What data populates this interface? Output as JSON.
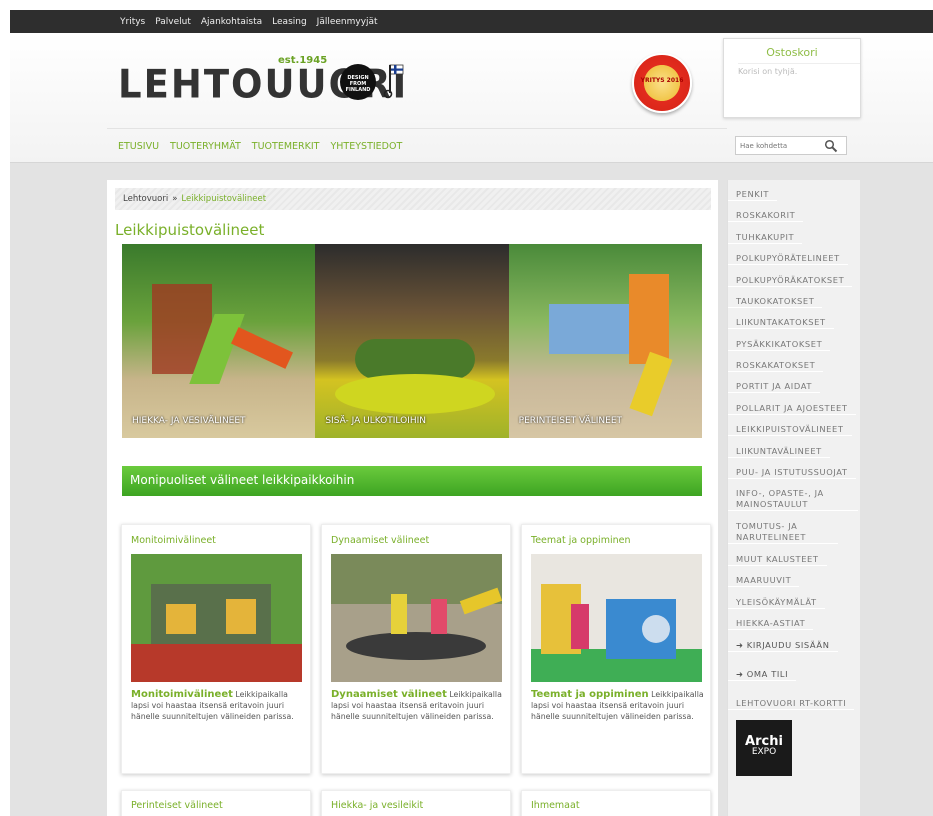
{
  "topnav": [
    "Yritys",
    "Palvelut",
    "Ajankohtaista",
    "Leasing",
    "Jälleenmyyjät"
  ],
  "logo": {
    "name": "LEHTOUUORI",
    "est": "est.1945"
  },
  "dff_badge": "DESIGN FROM FINLAND",
  "award_badge": "YRITYS 2016",
  "cart": {
    "title": "Ostoskori",
    "empty": "Korisi on tyhjä."
  },
  "mainnav": [
    "ETUSIVU",
    "TUOTERYHMÄT",
    "TUOTEMERKIT",
    "YHTEYSTIEDOT"
  ],
  "search": {
    "placeholder": "Hae kohdetta",
    "icon": "search-icon"
  },
  "breadcrumb": {
    "home": "Lehtovuori",
    "sep": "»",
    "current": "Leikkipuistovälineet"
  },
  "page_title": "Leikkipuistovälineet",
  "hero": [
    {
      "label": "HIEKKA- JA VESIVÄLINEET"
    },
    {
      "label": "SISÄ- JA ULKOTILOIHIN"
    },
    {
      "label": "PERINTEISET VÄLINEET"
    }
  ],
  "banner": "Monipuoliset välineet leikkipaikkoihin",
  "cards": [
    {
      "title": "Monitoimivälineet",
      "bold": "Monitoimivälineet",
      "text": " Leikkipaikalla lapsi voi haastaa itsensä eritavoin juuri hänelle suunniteltujen välineiden parissa."
    },
    {
      "title": "Dynaamiset välineet",
      "bold": "Dynaamiset välineet",
      "text": " Leikkipaikalla lapsi voi haastaa itsensä eritavoin juuri hänelle suunniteltujen välineiden parissa."
    },
    {
      "title": "Teemat ja oppiminen",
      "bold": "Teemat ja oppiminen",
      "text": " Leikkipaikalla lapsi voi haastaa itsensä eritavoin juuri hänelle suunniteltujen välineiden parissa."
    }
  ],
  "cards_row2": [
    {
      "title": "Perinteiset välineet"
    },
    {
      "title": "Hiekka- ja vesileikit"
    },
    {
      "title": "Ihmemaat"
    }
  ],
  "sidebar": [
    "PENKIT",
    "ROSKAKORIT",
    "TUHKAKUPIT",
    "POLKUPYÖRÄTELINEET",
    "POLKUPYÖRÄKATOKSET",
    "TAUKOKATOKSET",
    "LIIKUNTAKATOKSET",
    "PYSÄKKIKATOKSET",
    "ROSKAKATOKSET",
    "PORTIT JA AIDAT",
    "POLLARIT JA AJOESTEET",
    "LEIKKIPUISTOVÄLINEET",
    "LIIKUNTAVÄLINEET",
    "PUU- JA ISTUTUSSUOJAT",
    "INFO-, OPASTE-, JA MAINOSTAULUT",
    "TOMUTUS- JA NARUTELINEET",
    "MUUT KALUSTEET",
    "MAARUUVIT",
    "YLEISÖKÄYMÄLÄT",
    "HIEKKA-ASTIAT"
  ],
  "login": "➜ KIRJAUDU SISÄÄN",
  "account": "➜ OMA TILI",
  "rt": "LEHTOVUORI RT-KORTTI",
  "archi": {
    "a1": "Archi",
    "a2": "EXPO"
  }
}
